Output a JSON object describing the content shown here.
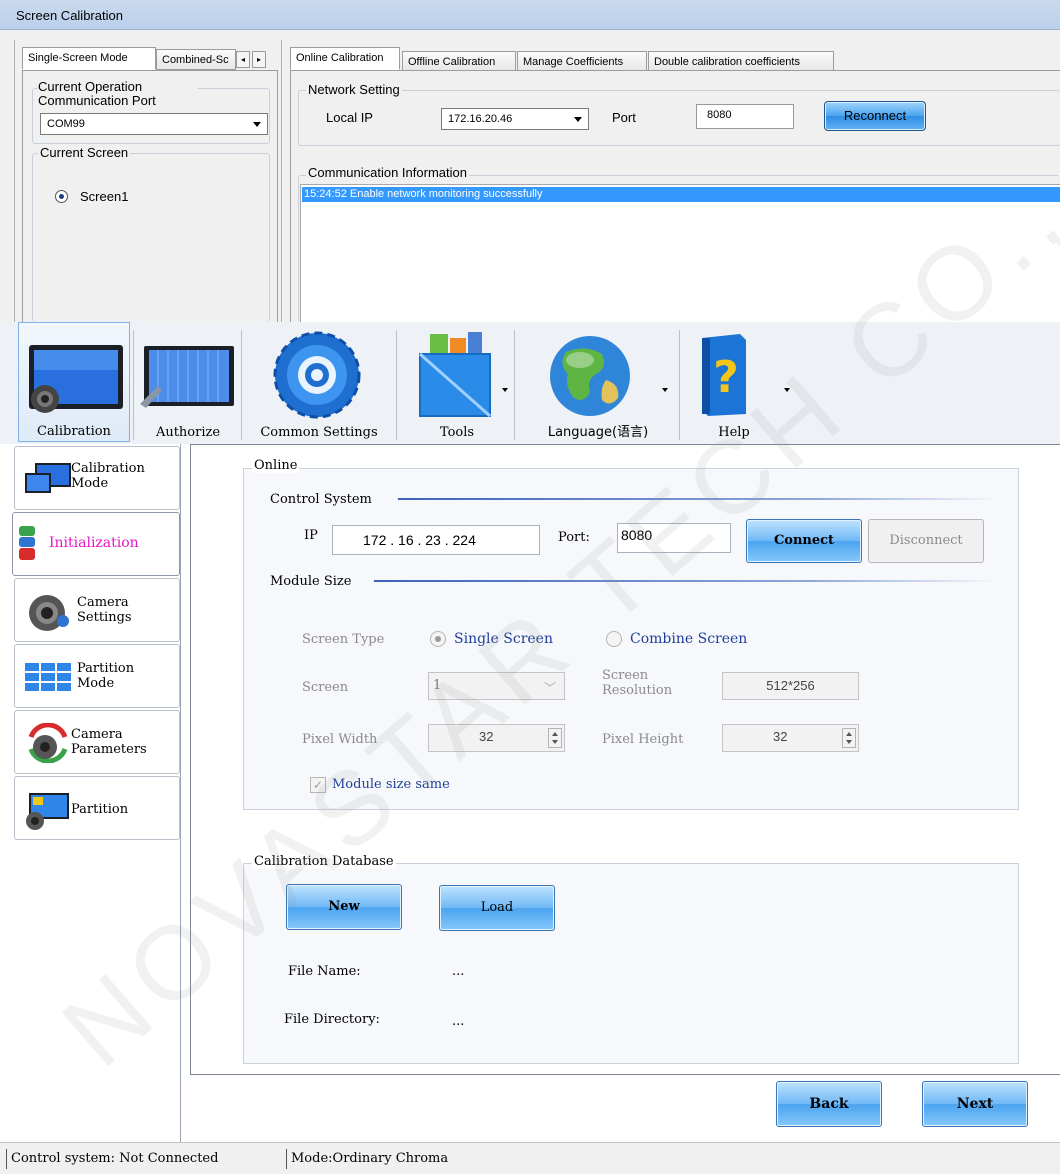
{
  "top_window": {
    "title": "Screen Calibration",
    "mode_tabs": [
      "Single-Screen Mode",
      "Combined-Sc"
    ],
    "current_operation_label": "Current Operation Communication Port",
    "port_value": "COM99",
    "current_screen_label": "Current Screen",
    "screen_option": "Screen1",
    "calib_tabs": [
      "Online Calibration",
      "Offline Calibration",
      "Manage Coefficients",
      "Double calibration coefficients"
    ],
    "network_setting_label": "Network Setting",
    "local_ip_label": "Local IP",
    "local_ip_value": "172.16.20.46",
    "port_label": "Port",
    "port_number": "8080",
    "reconnect_label": "Reconnect",
    "comm_info_label": "Communication Information",
    "log_entries": [
      "15:24:52  Enable network monitoring successfully"
    ]
  },
  "toolbar": {
    "items": [
      {
        "label": "Calibration",
        "icon": "monitor-camera-icon"
      },
      {
        "label": "Authorize",
        "icon": "authorize-screen-icon"
      },
      {
        "label": "Common Settings",
        "icon": "gear-icon"
      },
      {
        "label": "Tools",
        "icon": "toolbox-icon"
      },
      {
        "label": "Language(语言)",
        "icon": "globe-icon"
      },
      {
        "label": "Help",
        "icon": "help-book-icon"
      }
    ]
  },
  "sidebar": {
    "items": [
      {
        "label1": "Calibration",
        "label2": "Mode"
      },
      {
        "label1": "Initialization",
        "label2": ""
      },
      {
        "label1": "Camera",
        "label2": "Settings"
      },
      {
        "label1": "Partition",
        "label2": "Mode"
      },
      {
        "label1": "Camera",
        "label2": "Parameters"
      },
      {
        "label1": "Partition",
        "label2": ""
      }
    ]
  },
  "online": {
    "group_label": "Online",
    "control_system_label": "Control System",
    "ip_label": "IP",
    "ip_value": "172 . 16 . 23 . 224",
    "port_label": "Port:",
    "port_value": "8080",
    "connect_label": "Connect",
    "disconnect_label": "Disconnect",
    "module_size_label": "Module Size",
    "screen_type_label": "Screen Type",
    "single_screen_label": "Single Screen",
    "combine_screen_label": "Combine Screen",
    "screen_label": "Screen",
    "screen_value": "1",
    "screen_res_label1": "Screen",
    "screen_res_label2": "Resolution",
    "screen_res_value": "512*256",
    "pixel_width_label": "Pixel Width",
    "pixel_width_value": "32",
    "pixel_height_label": "Pixel Height",
    "pixel_height_value": "32",
    "module_same_label": "Module size same"
  },
  "database": {
    "group_label": "Calibration Database",
    "new_label": "New",
    "load_label": "Load",
    "file_name_label": "File Name:",
    "file_name_value": "...",
    "file_dir_label": "File Directory:",
    "file_dir_value": "..."
  },
  "nav": {
    "back_label": "Back",
    "next_label": "Next"
  },
  "status": {
    "control": "Control system: Not Connected",
    "mode": "Mode:Ordinary Chroma"
  },
  "watermark": "NOVASTAR TECH CO., LTD"
}
